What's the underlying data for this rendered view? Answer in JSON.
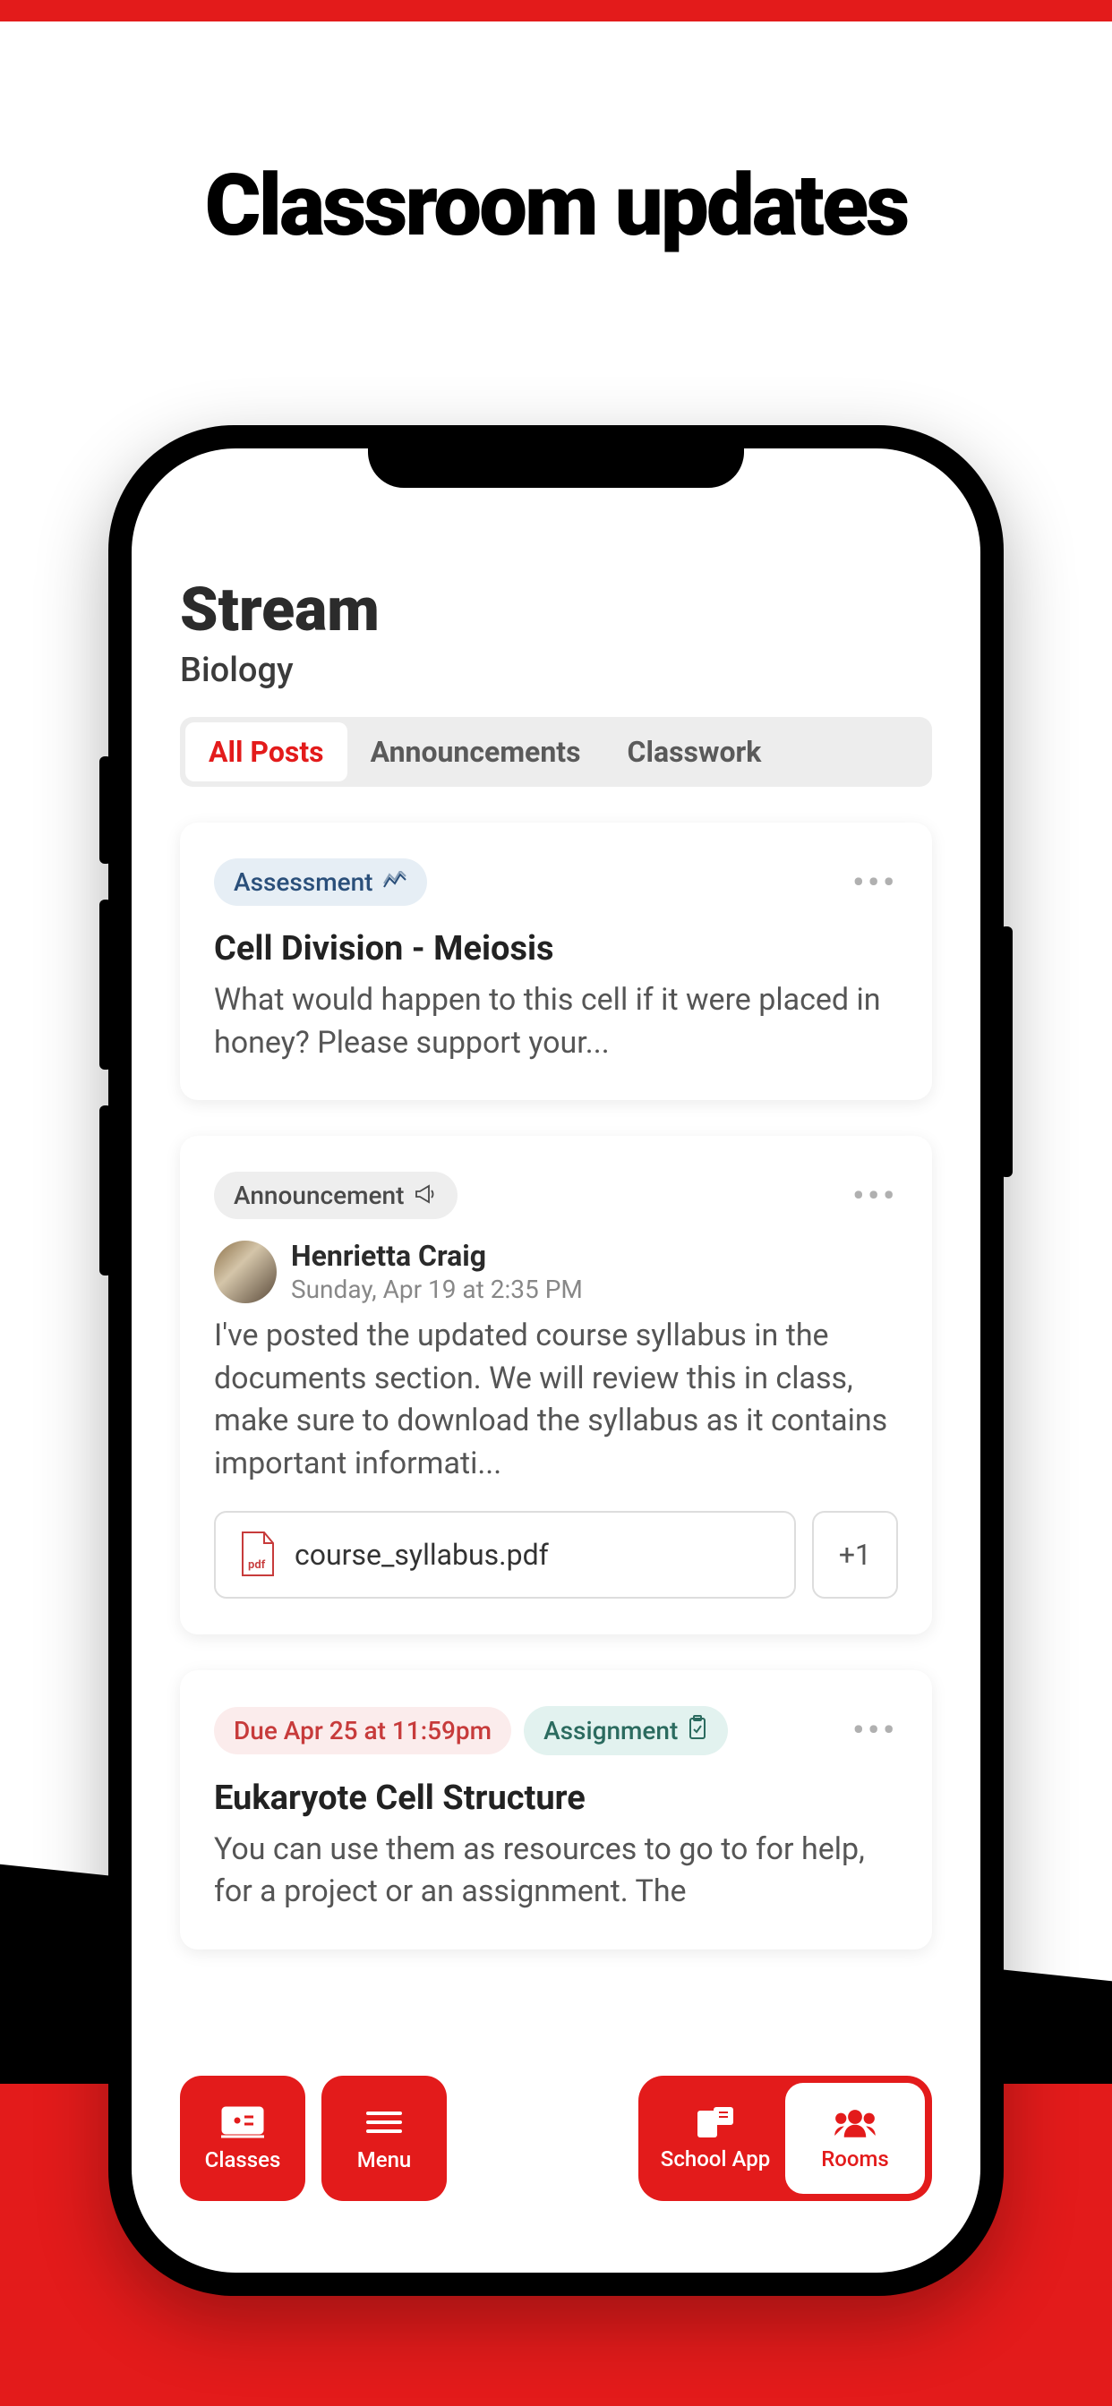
{
  "hero": {
    "title": "Classroom updates"
  },
  "stream": {
    "title": "Stream",
    "subtitle": "Biology",
    "tabs": [
      {
        "label": "All Posts",
        "active": true
      },
      {
        "label": "Announcements",
        "active": false
      },
      {
        "label": "Classwork",
        "active": false
      }
    ]
  },
  "posts": [
    {
      "chip": "Assessment",
      "chipColor": "blue",
      "title": "Cell Division - Meiosis",
      "body": "What would happen to this cell if it were placed in honey? Please support your..."
    },
    {
      "chip": "Announcement",
      "chipColor": "gray",
      "author": "Henrietta Craig",
      "time": "Sunday, Apr 19 at 2:35 PM",
      "body": "I've posted the updated course syllabus in the documents section. We will review this in class, make sure to download the syllabus as it contains important informati...",
      "attachment": "course_syllabus.pdf",
      "more": "+1"
    },
    {
      "due": "Due Apr 25 at 11:59pm",
      "chip": "Assignment",
      "chipColor": "teal",
      "title": "Eukaryote Cell Structure",
      "body": "You can use them as resources to go to for help, for a project or an assignment. The"
    }
  ],
  "nav": {
    "classes": "Classes",
    "menu": "Menu",
    "schoolApp": "School App",
    "rooms": "Rooms"
  }
}
